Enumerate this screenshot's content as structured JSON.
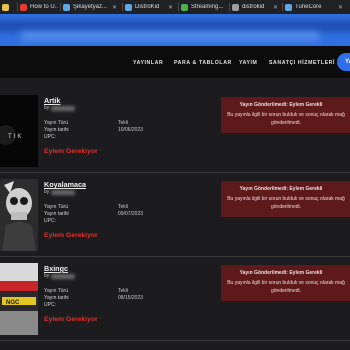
{
  "browser": {
    "tabs": [
      {
        "label": "",
        "color": "#e8c34a"
      },
      {
        "label": "How to U...",
        "color": "#e63b2e"
      },
      {
        "label": "Şikayetyaz...",
        "color": "#5fa8e6"
      },
      {
        "label": "DistroKid",
        "color": "#5fa8e6"
      },
      {
        "label": "Streaming...",
        "color": "#4caf50"
      },
      {
        "label": "distrokid",
        "color": "#9e9e9e"
      },
      {
        "label": "TuneCore",
        "color": "#5fa8e6"
      }
    ]
  },
  "nav": {
    "items": [
      "YAYINLAR",
      "PARA & TABLOLAR",
      "YAYIM",
      "SANATÇI HİZMETLERİ"
    ],
    "cta": "YA"
  },
  "labels": {
    "by": "by",
    "type": "Yayın Türü",
    "date": "Yayın tarihi",
    "upc": "UPC:"
  },
  "releases": [
    {
      "title": "Artik",
      "type": "Tekli",
      "date": "10/06/2023",
      "action": "Eylem Gerekiyor",
      "notice_title": "Yayın Gönderilmedi: Eylem Gerekli",
      "notice_body": "Bu yayınla ilgili bir sorun bulduk ve sonuç olarak mağ gönderilmedi.",
      "cover_text": "TIK"
    },
    {
      "title": "Koyalamaca",
      "type": "Tekli",
      "date": "09/07/2023",
      "action": "Eylem Gerekiyor",
      "notice_title": "Yayın Gönderilmedi: Eylem Gerekli",
      "notice_body": "Bu yayınla ilgili bir sorun bulduk ve sonuç olarak mağ gönderilmedi.",
      "cover_text": ""
    },
    {
      "title": "Bxingc",
      "type": "Tekli",
      "date": "08/15/2023",
      "action": "Eylem Gerekiyor",
      "notice_title": "Yayın Gönderilmedi: Eylem Gerekli",
      "notice_body": "Bu yayınla ilgili bir sorun bulduk ve sonuç olarak mağ gönderilmedi.",
      "cover_text": "NGC"
    }
  ]
}
